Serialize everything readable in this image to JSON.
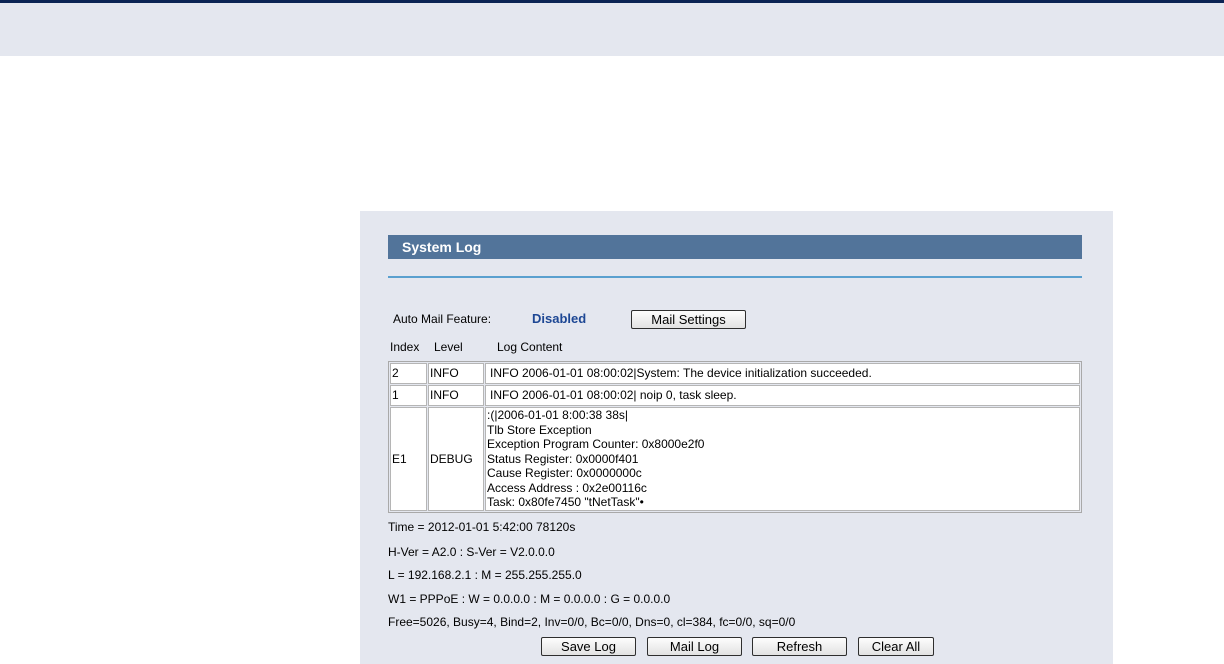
{
  "page": {
    "title": "System Log"
  },
  "auto_mail": {
    "label": "Auto Mail Feature:",
    "status": "Disabled",
    "settings_button": "Mail Settings"
  },
  "columns": {
    "index": "Index",
    "level": "Level",
    "content": "Log Content"
  },
  "log_entries": [
    {
      "index": "2",
      "level": "INFO",
      "lines": [
        "INFO 2006-01-01 08:00:02|System: The device initialization succeeded."
      ]
    },
    {
      "index": "1",
      "level": "INFO",
      "lines": [
        "INFO 2006-01-01 08:00:02| noip 0, task sleep."
      ]
    },
    {
      "index": "E1",
      "level": "DEBUG",
      "lines": [
        ":(|2006-01-01 8:00:38 38s|",
        "Tlb Store Exception",
        "Exception Program Counter: 0x8000e2f0",
        "Status Register: 0x0000f401",
        "Cause Register: 0x0000000c",
        "Access Address : 0x2e00116c",
        "Task: 0x80fe7450 \"tNetTask\"•"
      ]
    }
  ],
  "status_info": {
    "time": "Time = 2012-01-01 5:42:00 78120s",
    "version": "H-Ver = A2.0 : S-Ver = V2.0.0.0",
    "lan": "L = 192.168.2.1 : M = 255.255.255.0",
    "wan": "W1 = PPPoE : W = 0.0.0.0 : M = 0.0.0.0 : G = 0.0.0.0",
    "free": "Free=5026, Busy=4, Bind=2, Inv=0/0, Bc=0/0, Dns=0, cl=384, fc=0/0, sq=0/0"
  },
  "buttons": {
    "save_log": "Save Log",
    "mail_log": "Mail Log",
    "refresh": "Refresh",
    "clear_all": "Clear All"
  },
  "colors": {
    "top_bar": "#0b2454",
    "band": "#e4e7ef",
    "title_bar": "#52749a",
    "title_rule": "#5aa0cf",
    "status_disabled": "#1d4794"
  }
}
